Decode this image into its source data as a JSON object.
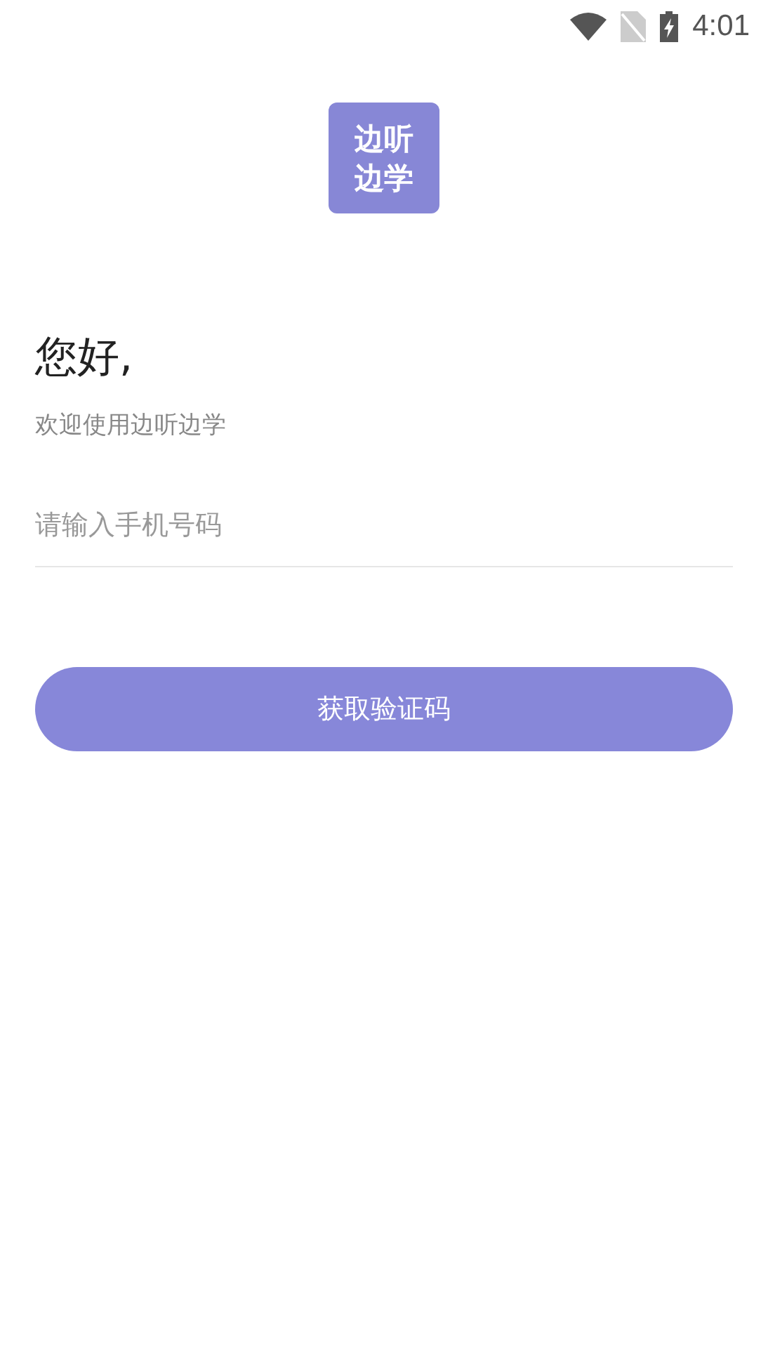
{
  "status_bar": {
    "time": "4:01"
  },
  "logo": {
    "lines": [
      "边听",
      "边学"
    ]
  },
  "greeting": "您好,",
  "subtitle": "欢迎使用边听边学",
  "phone_field": {
    "placeholder": "请输入手机号码"
  },
  "buttons": [
    "获取验证码"
  ]
}
